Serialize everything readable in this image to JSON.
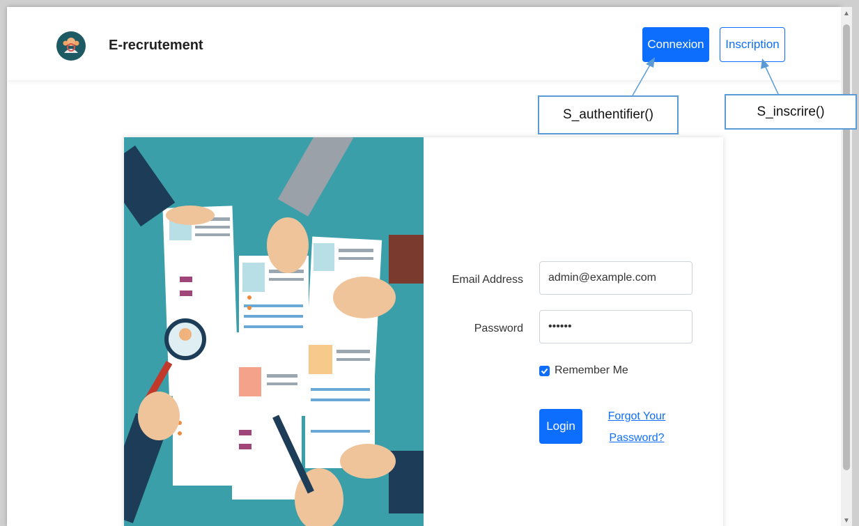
{
  "navbar": {
    "brand": "E-recrutement",
    "connexion_label": "Connexion",
    "inscription_label": "Inscription"
  },
  "form": {
    "email_label": "Email Address",
    "email_value": "admin@example.com",
    "password_label": "Password",
    "password_value": "••••••",
    "remember_label": "Remember Me",
    "remember_checked": true,
    "login_label": "Login",
    "forgot_line1": "Forgot Your",
    "forgot_line2": "Password?"
  },
  "annotations": {
    "authentifier": "S_authentifier()",
    "inscrire": "S_inscrire()"
  },
  "colors": {
    "primary": "#0d6efd",
    "teal_background": "#3a9fa9",
    "annotation_border": "#5b9bd5"
  },
  "icons": {
    "logo": "recruitment-logo-icon",
    "checkbox": "checkmark-icon"
  }
}
